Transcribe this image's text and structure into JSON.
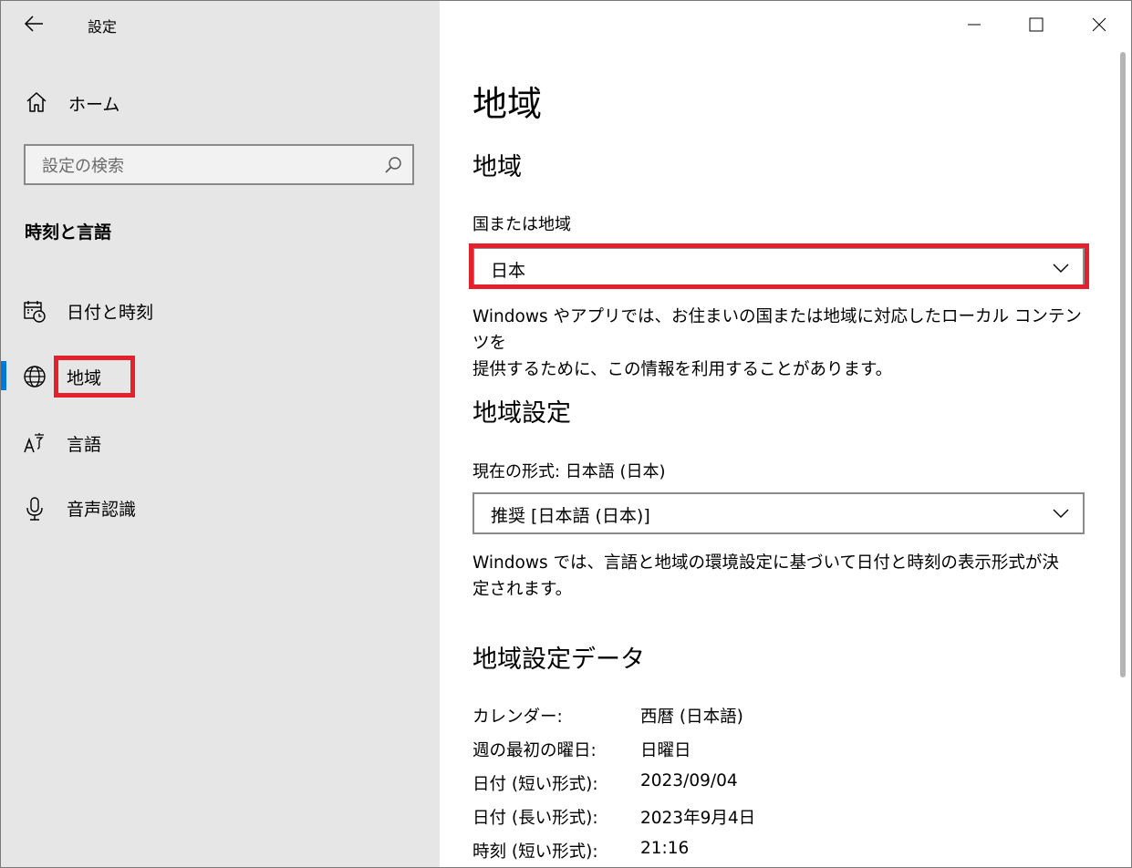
{
  "app": {
    "title": "設定"
  },
  "sidebar": {
    "home_label": "ホーム",
    "search_placeholder": "設定の検索",
    "section_heading": "時刻と言語",
    "items": [
      {
        "label": "日付と時刻",
        "icon": "calendar-clock-icon"
      },
      {
        "label": "地域",
        "icon": "globe-icon",
        "active": true
      },
      {
        "label": "言語",
        "icon": "language-icon"
      },
      {
        "label": "音声認識",
        "icon": "microphone-icon"
      }
    ]
  },
  "main": {
    "page_title": "地域",
    "region_section": {
      "heading": "地域",
      "field_label": "国または地域",
      "selected": "日本",
      "description_line1": "Windows やアプリでは、お住まいの国または地域に対応したローカル コンテンツを",
      "description_line2": "提供するために、この情報を利用することがあります。"
    },
    "format_section": {
      "heading": "地域設定",
      "field_label": "現在の形式: 日本語 (日本)",
      "selected": "推奨 [日本語 (日本)]",
      "description_line1": "Windows では、言語と地域の環境設定に基づいて日付と時刻の表示形式が決",
      "description_line2": "定されます。"
    },
    "data_section": {
      "heading": "地域設定データ",
      "rows": [
        {
          "key": "カレンダー:",
          "value": "西暦 (日本語)"
        },
        {
          "key": "週の最初の曜日:",
          "value": "日曜日"
        },
        {
          "key": "日付 (短い形式):",
          "value": "2023/09/04"
        },
        {
          "key": "日付 (長い形式):",
          "value": "2023年9月4日"
        },
        {
          "key": "時刻 (短い形式):",
          "value": "21:16"
        }
      ]
    }
  },
  "colors": {
    "accent": "#0078d7",
    "highlight": "#e3202c",
    "sidebar_bg": "#e6e6e6"
  }
}
